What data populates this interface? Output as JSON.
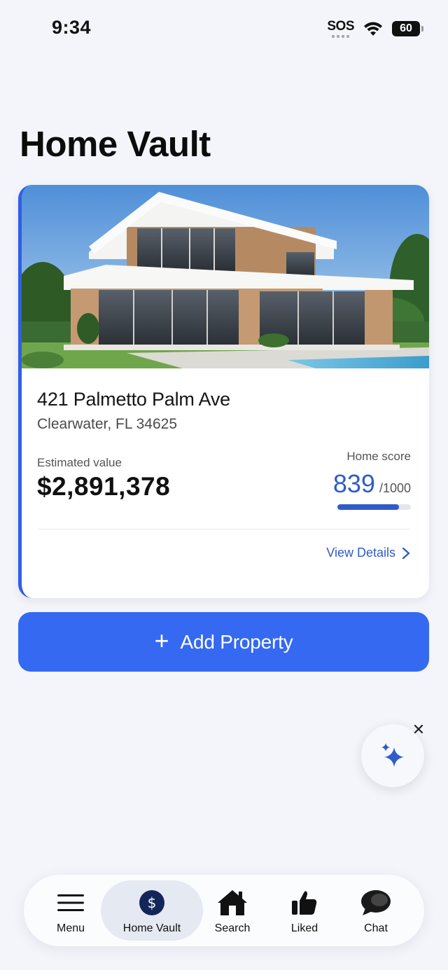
{
  "status_bar": {
    "time": "9:34",
    "carrier": "SOS",
    "battery": "60"
  },
  "page": {
    "title": "Home Vault"
  },
  "property": {
    "address": "421 Palmetto Palm Ave",
    "city": "Clearwater, FL 34625",
    "estimated_label": "Estimated value",
    "estimated_value": "$2,891,378",
    "score_label": "Home score",
    "score_value": "839",
    "score_max": "/1000",
    "score_fraction": 0.839,
    "view_details": "View Details"
  },
  "add_button": {
    "icon": "+",
    "label": "Add Property"
  },
  "nav": {
    "items": [
      {
        "label": "Menu",
        "icon": "menu-icon"
      },
      {
        "label": "Home Vault",
        "icon": "dollar-icon"
      },
      {
        "label": "Search",
        "icon": "house-icon"
      },
      {
        "label": "Liked",
        "icon": "thumbs-up-icon"
      },
      {
        "label": "Chat",
        "icon": "chat-icon"
      }
    ],
    "active": "Home Vault"
  },
  "colors": {
    "accent": "#3569f2",
    "score": "#2f5cc9",
    "background": "#f3f5fa"
  }
}
